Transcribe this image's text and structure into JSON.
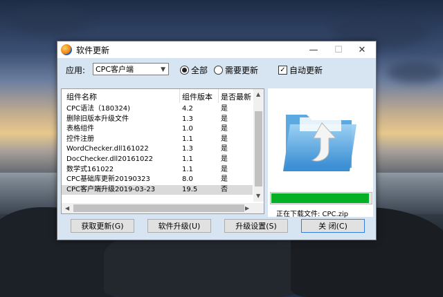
{
  "window": {
    "title": "软件更新",
    "minimize_glyph": "—",
    "maximize_glyph": "☐",
    "close_glyph": "✕"
  },
  "toolbar": {
    "app_label": "应用:",
    "app_select_value": "CPC客户端",
    "radio_all_label": "全部",
    "radio_needs_update_label": "需要更新",
    "auto_update_label": "自动更新",
    "selected_filter": "全部",
    "auto_update_checked": true
  },
  "list": {
    "columns": [
      "组件名称",
      "组件版本",
      "是否最新"
    ],
    "rows": [
      {
        "name": "CPC语法（180324)",
        "version": "4.2",
        "latest": "是"
      },
      {
        "name": "删除旧版本升级文件",
        "version": "1.3",
        "latest": "是"
      },
      {
        "name": "表格组件",
        "version": "1.0",
        "latest": "是"
      },
      {
        "name": "控件注册",
        "version": "1.1",
        "latest": "是"
      },
      {
        "name": "WordChecker.dll161022",
        "version": "1.3",
        "latest": "是"
      },
      {
        "name": "DocChecker.dll20161022",
        "version": "1.1",
        "latest": "是"
      },
      {
        "name": "数学式161022",
        "version": "1.1",
        "latest": "是"
      },
      {
        "name": "CPC基础库更新20190323",
        "version": "8.0",
        "latest": "是"
      },
      {
        "name": "CPC客户端升级2019-03-23",
        "version": "19.5",
        "latest": "否"
      }
    ],
    "selected_index": 8
  },
  "status": {
    "download_text": "正在下载文件: CPC.zip",
    "progress_fraction": 0.98
  },
  "icons": {
    "app": "app-logo-icon",
    "folder": "folder-upload-icon"
  },
  "buttons": {
    "fetch": "获取更新(G)",
    "upgrade": "软件升级(U)",
    "settings": "升级设置(S)",
    "close": "关 闭(C)"
  },
  "colors": {
    "progress": "#06b025",
    "window_body": "#d7e4f2"
  }
}
